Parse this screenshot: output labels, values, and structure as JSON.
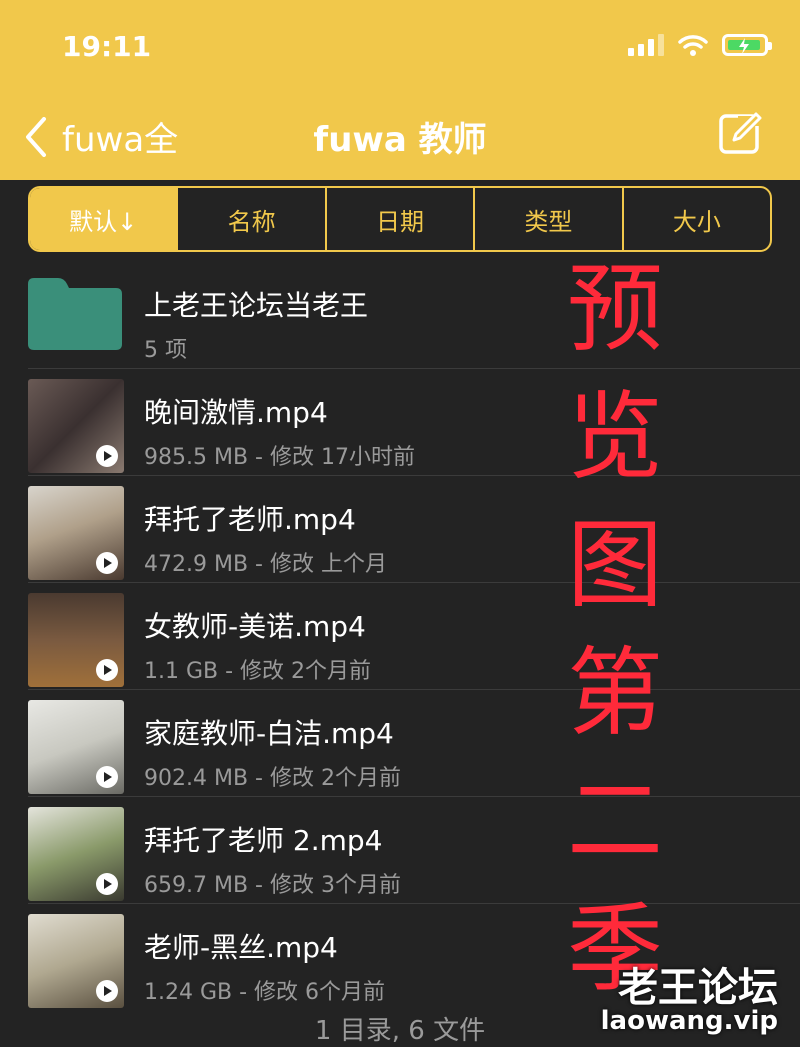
{
  "status_bar": {
    "time": "19:11",
    "icons": [
      "cellular-signal-icon",
      "wifi-icon",
      "battery-charging-icon"
    ]
  },
  "nav": {
    "back_label": "fuwa全",
    "title": "fuwa 教师",
    "edit_icon": "edit-square-icon"
  },
  "sort_tabs": [
    {
      "label": "默认↓",
      "selected": true
    },
    {
      "label": "名称",
      "selected": false
    },
    {
      "label": "日期",
      "selected": false
    },
    {
      "label": "类型",
      "selected": false
    },
    {
      "label": "大小",
      "selected": false
    }
  ],
  "items": [
    {
      "type": "folder",
      "name": "上老王论坛当老王",
      "meta": "5  项"
    },
    {
      "type": "video",
      "name": "晚间激情.mp4",
      "meta": "985.5 MB - 修改 17小时前"
    },
    {
      "type": "video",
      "name": "拜托了老师.mp4",
      "meta": "472.9 MB - 修改 上个月"
    },
    {
      "type": "video",
      "name": "女教师-美诺.mp4",
      "meta": "1.1 GB - 修改 2个月前"
    },
    {
      "type": "video",
      "name": "家庭教师-白洁.mp4",
      "meta": "902.4 MB - 修改 2个月前"
    },
    {
      "type": "video",
      "name": "拜托了老师 2.mp4",
      "meta": "659.7 MB - 修改 3个月前"
    },
    {
      "type": "video",
      "name": "老师-黑丝.mp4",
      "meta": "1.24 GB - 修改 6个月前"
    }
  ],
  "footer": "1 目录, 6 文件",
  "overlay": {
    "chars": [
      "预",
      "览",
      "图",
      "第",
      "二",
      "季"
    ],
    "color": "#ff2a3a"
  },
  "watermark": {
    "name": "老王论坛",
    "url": "laowang.vip"
  },
  "colors": {
    "accent": "#f1c84b",
    "background": "#232323",
    "folder": "#3a8f7a"
  }
}
